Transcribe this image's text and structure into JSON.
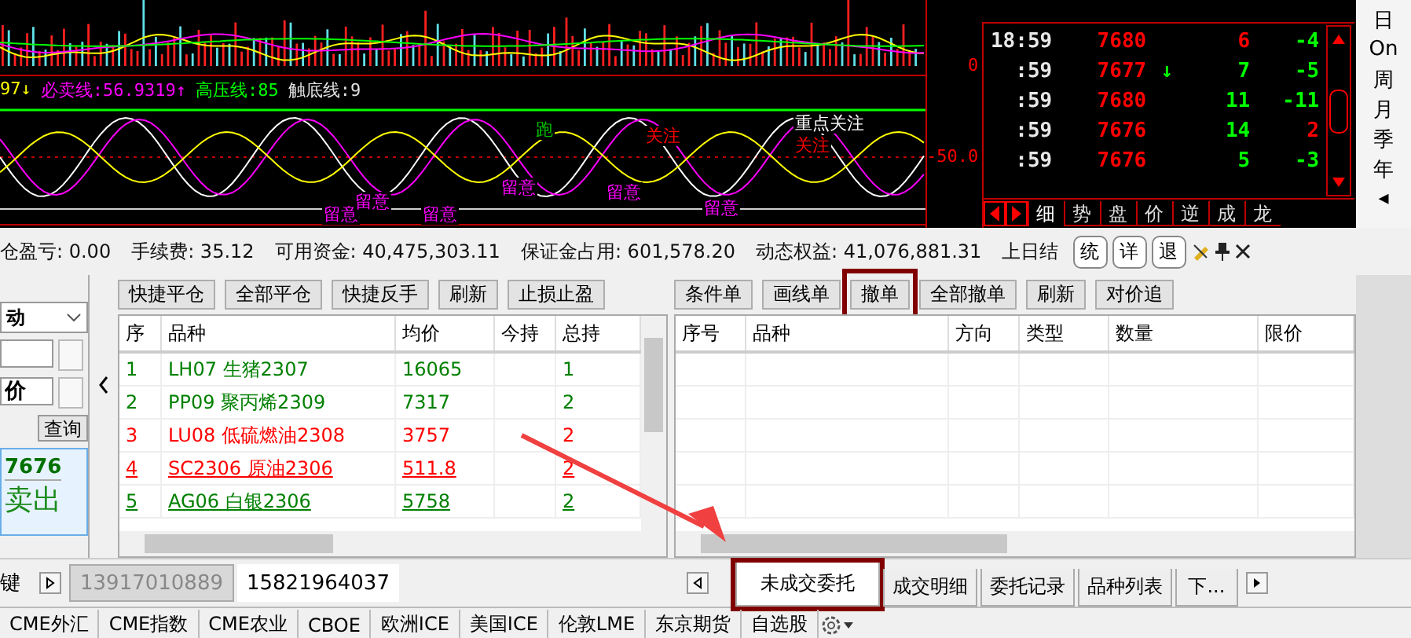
{
  "chart": {
    "indicator": [
      {
        "text": "97↓",
        "color": "#ffff00"
      },
      {
        "text": "必卖线:56.9319↑",
        "color": "#ff00ff"
      },
      {
        "text": "高压线:85",
        "color": "#00ff00"
      },
      {
        "text": "触底线:9",
        "color": "#e0e0e0"
      }
    ],
    "markers": [
      {
        "text": "跑",
        "color": "#00c000"
      },
      {
        "text": "关注",
        "color": "#ff0000"
      },
      {
        "text": "重点关注",
        "color": "#ffffff"
      },
      {
        "text": "关注",
        "color": "#ff0000"
      },
      {
        "text": "留意",
        "color": "#ff00ff"
      },
      {
        "text": "留意",
        "color": "#ff00ff"
      },
      {
        "text": "留意",
        "color": "#ff00ff"
      },
      {
        "text": "留意",
        "color": "#ff00ff"
      },
      {
        "text": "留意",
        "color": "#ff00ff"
      },
      {
        "text": "留意",
        "color": "#ff00ff"
      }
    ],
    "axis_labels": [
      "0",
      "-50.0"
    ]
  },
  "ticks": {
    "rows": [
      {
        "time": "18:59",
        "price": "7680",
        "arrow": "",
        "volume": {
          "text": "6",
          "color": "#ff0000"
        },
        "change": {
          "text": "-4",
          "color": "#00ff00"
        }
      },
      {
        "time": ":59",
        "price": "7677",
        "arrow": "↓",
        "volume": {
          "text": "7",
          "color": "#00ff00"
        },
        "change": {
          "text": "-5",
          "color": "#00ff00"
        }
      },
      {
        "time": ":59",
        "price": "7680",
        "arrow": "",
        "volume": {
          "text": "11",
          "color": "#00ff00"
        },
        "change": {
          "text": "-11",
          "color": "#00ff00"
        }
      },
      {
        "time": ":59",
        "price": "7676",
        "arrow": "",
        "volume": {
          "text": "14",
          "color": "#00ff00"
        },
        "change": {
          "text": "2",
          "color": "#ff0000"
        }
      },
      {
        "time": ":59",
        "price": "7676",
        "arrow": "",
        "volume": {
          "text": "5",
          "color": "#00ff00"
        },
        "change": {
          "text": "-3",
          "color": "#00ff00"
        }
      }
    ],
    "tabs": [
      {
        "label": "细",
        "selected": true
      },
      {
        "label": "势",
        "selected": false
      },
      {
        "label": "盘",
        "selected": false
      },
      {
        "label": "价",
        "selected": false
      },
      {
        "label": "逆",
        "selected": false
      },
      {
        "label": "成",
        "selected": false
      },
      {
        "label": "龙",
        "selected": false
      }
    ]
  },
  "period_buttons": [
    "日",
    "On",
    "周",
    "月",
    "季",
    "年",
    "◂"
  ],
  "account": {
    "fields": [
      {
        "label": "仓盈亏:",
        "value": "0.00"
      },
      {
        "label": "手续费:",
        "value": "35.12"
      },
      {
        "label": "可用资金:",
        "value": "40,475,303.11"
      },
      {
        "label": "保证金占用:",
        "value": "601,578.20"
      },
      {
        "label": "动态权益:",
        "value": "41,076,881.31"
      }
    ],
    "tail": "上日结",
    "buttons": [
      "统",
      "详",
      "退"
    ]
  },
  "order": {
    "dropdown": "动",
    "price_type": "价",
    "query": "查询",
    "price": "7676",
    "action": "卖出",
    "key": "键"
  },
  "positions": {
    "buttons": [
      {
        "label": "快捷平仓",
        "highlighted": false
      },
      {
        "label": "全部平仓",
        "highlighted": false
      },
      {
        "label": "快捷反手",
        "highlighted": false
      },
      {
        "label": "刷新",
        "highlighted": false
      },
      {
        "label": "止损止盈",
        "highlighted": false
      }
    ],
    "columns": [
      "序",
      "品种",
      "均价",
      "今持",
      "总持"
    ],
    "rows": [
      {
        "cells": [
          "1",
          "LH07 生猪2307",
          "16065",
          "",
          "1"
        ],
        "color": "#008000",
        "underlined": false
      },
      {
        "cells": [
          "2",
          "PP09 聚丙烯2309",
          "7317",
          "",
          "2"
        ],
        "color": "#008000",
        "underlined": false
      },
      {
        "cells": [
          "3",
          "LU08 低硫燃油2308",
          "3757",
          "",
          "2"
        ],
        "color": "#ff0000",
        "underlined": false
      },
      {
        "cells": [
          "4",
          "SC2306 原油2306",
          "511.8",
          "",
          "2"
        ],
        "color": "#ff0000",
        "underlined": true
      },
      {
        "cells": [
          "5",
          "AG06 白银2306",
          "5758",
          "",
          "2"
        ],
        "color": "#008000",
        "underlined": true
      }
    ]
  },
  "orders": {
    "buttons": [
      {
        "label": "条件单",
        "highlighted": false
      },
      {
        "label": "画线单",
        "highlighted": false
      },
      {
        "label": "撤单",
        "highlighted": true
      },
      {
        "label": "全部撤单",
        "highlighted": false
      },
      {
        "label": "刷新",
        "highlighted": false
      },
      {
        "label": "对价追",
        "highlighted": false
      }
    ],
    "columns": [
      "序号",
      "品种",
      "方向",
      "类型",
      "数量",
      "限价"
    ]
  },
  "accounts": [
    {
      "label": "13917010889",
      "selected": false
    },
    {
      "label": "15821964037",
      "selected": true
    }
  ],
  "tabs": [
    {
      "label": "未成交委托",
      "selected": true,
      "highlighted": true
    },
    {
      "label": "成交明细",
      "selected": false,
      "highlighted": false
    },
    {
      "label": "委托记录",
      "selected": false,
      "highlighted": false
    },
    {
      "label": "品种列表",
      "selected": false,
      "highlighted": false
    },
    {
      "label": "下...",
      "selected": false,
      "highlighted": false
    }
  ],
  "markets": [
    "CME外汇",
    "CME指数",
    "CME农业",
    "CBOE",
    "欧洲ICE",
    "美国ICE",
    "伦敦LME",
    "东京期货",
    "自选股"
  ]
}
